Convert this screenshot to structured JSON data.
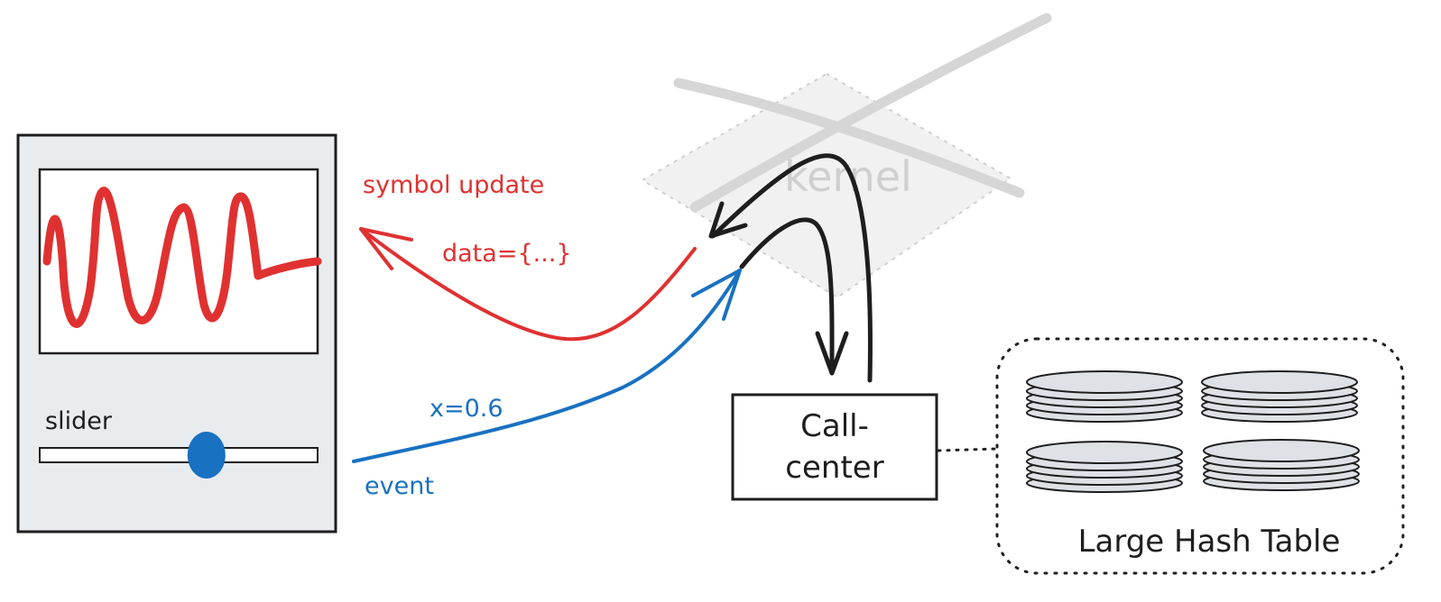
{
  "labels": {
    "kernel": "kernel",
    "symbol_update": "symbol update",
    "data": "data={...}",
    "x_value": "x=0.6",
    "event": "event",
    "slider": "slider",
    "callcenter_line1": "Call-",
    "callcenter_line2": "center",
    "hash_table": "Large Hash Table"
  },
  "slider": {
    "value": 0.6
  },
  "colors": {
    "red": "#e03131",
    "blue": "#1971c2",
    "dark": "#1e1e1e",
    "panel": "#e9ecef",
    "disk": "#dee2e6",
    "faded": "#cfcfcf"
  }
}
